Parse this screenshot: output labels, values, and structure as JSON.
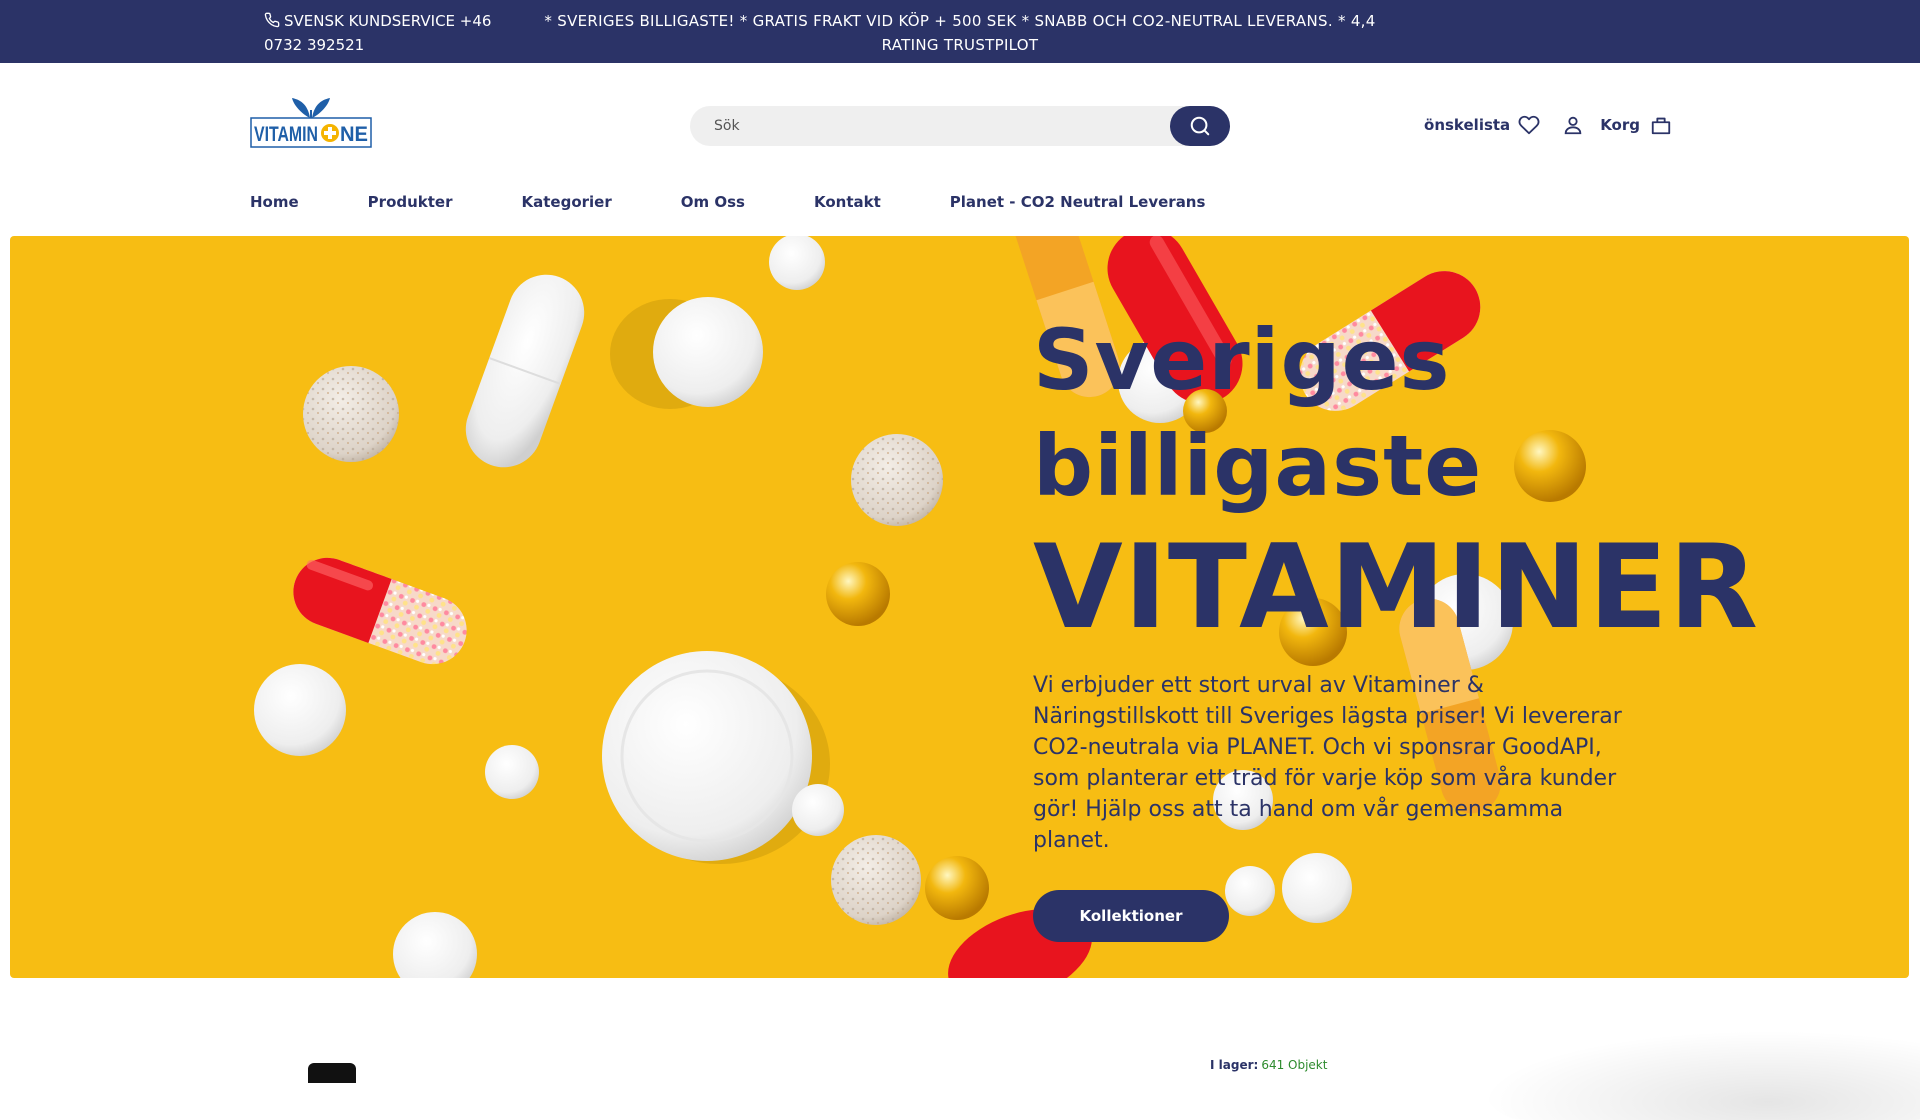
{
  "topbar": {
    "phone_label": "SVENSK KUNDSERVICE +46 0732 392521",
    "phone_icon": "phone-icon",
    "promo": "* SVERIGES BILLIGASTE! * GRATIS FRAKT VID KÖP + 500 SEK * SNABB OCH CO2-NEUTRAL LEVERANS. * 4,4 RATING TRUSTPILOT"
  },
  "header": {
    "logo_text": "VITAMIN+NE",
    "search": {
      "placeholder": "Sök",
      "icon": "search-icon"
    },
    "wishlist_label": "önskelista",
    "wishlist_icon": "heart-icon",
    "account_icon": "user-icon",
    "cart_label": "Korg",
    "cart_icon": "bag-icon"
  },
  "nav": {
    "items": [
      {
        "label": "Home"
      },
      {
        "label": "Produkter"
      },
      {
        "label": "Kategorier"
      },
      {
        "label": "Om Oss"
      },
      {
        "label": "Kontakt"
      },
      {
        "label": "Planet - CO2 Neutral Leverans"
      }
    ]
  },
  "hero": {
    "title_line1": "Sveriges",
    "title_line2": "billigaste",
    "title_line3": "VITAMINER",
    "text": "Vi erbjuder ett stort urval av Vitaminer & Näringstillskott till Sveriges lägsta priser! Vi levererar CO2-neutrala via PLANET. Och vi sponsrar GoodAPI, som planterar ett träd för varje köp som våra kunder gör! Hjälp oss att ta hand om vår gemensamma planet.",
    "button_label": "Kollektioner"
  },
  "stock": {
    "label": "I lager:",
    "count": "641 Objekt"
  },
  "colors": {
    "brand_navy": "#2b3367",
    "hero_yellow": "#f7bd13",
    "stock_green": "#2e8b2e"
  }
}
